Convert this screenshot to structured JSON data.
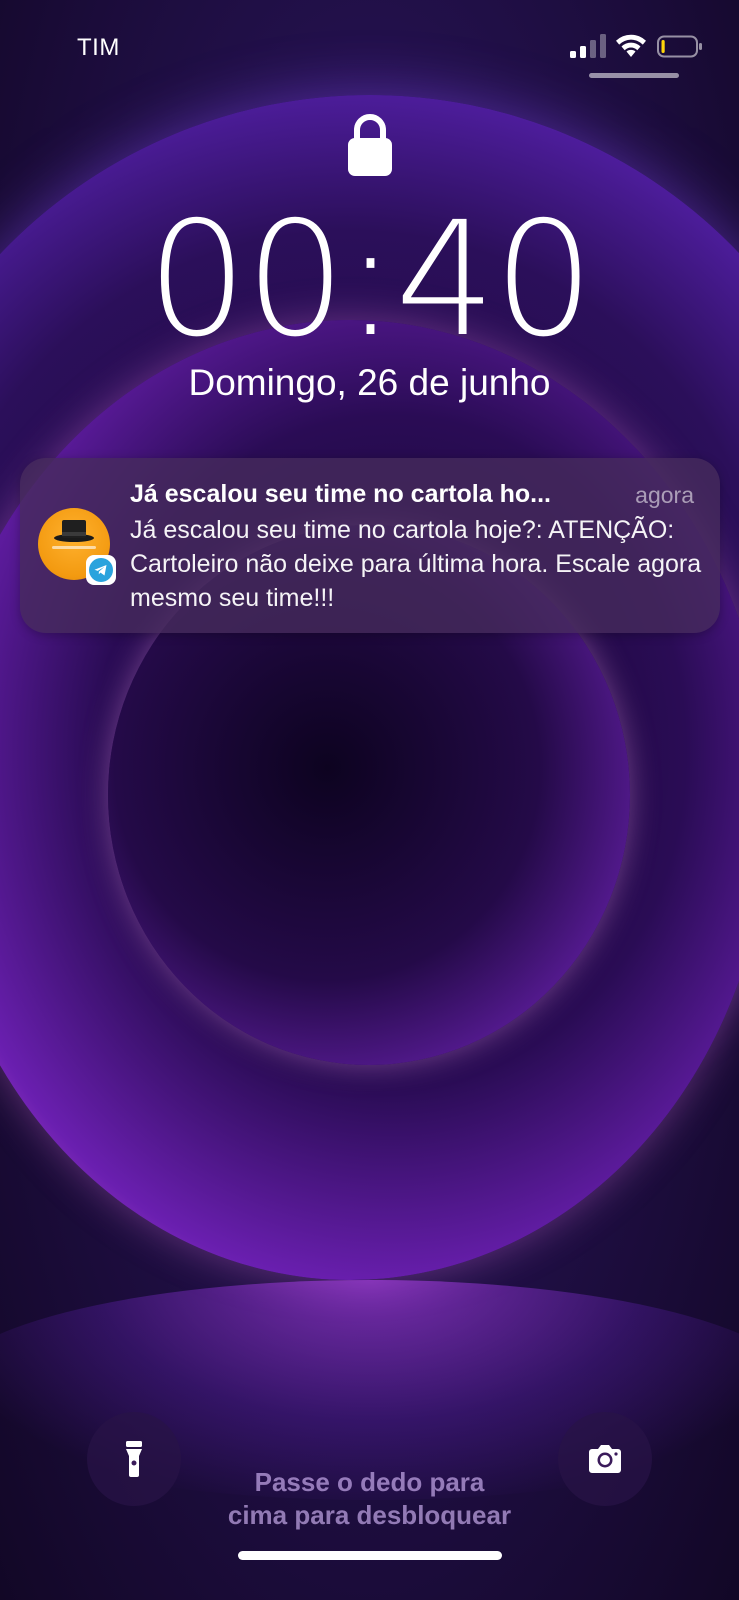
{
  "status_bar": {
    "carrier": "TIM",
    "signal_bars_filled": 2,
    "signal_bars_total": 4,
    "wifi_icon": "wifi-icon",
    "battery_level": 0.1,
    "battery_color": "#ffd60a"
  },
  "lock_screen": {
    "lock_icon": "lock-icon",
    "time": "00:40",
    "date": "Domingo, 26 de junho"
  },
  "notification": {
    "app_icon": "cartola-avatar",
    "source_badge": "telegram-icon",
    "title": "Já escalou seu time no cartola ho...",
    "time": "agora",
    "body": "Já escalou seu time no cartola hoje?: ATENÇÃO: Cartoleiro não deixe para última hora. Escale agora mesmo seu time!!!"
  },
  "bottom": {
    "flashlight_icon": "flashlight-icon",
    "camera_icon": "camera-icon",
    "unlock_hint_line1": "Passe o dedo para",
    "unlock_hint_line2": "cima para desbloquear"
  },
  "colors": {
    "accent_purple": "#6a1fb0",
    "orb_highlight": "#f4b0e8",
    "telegram_blue": "#2aa3dd",
    "avatar_orange": "#f39a10"
  }
}
